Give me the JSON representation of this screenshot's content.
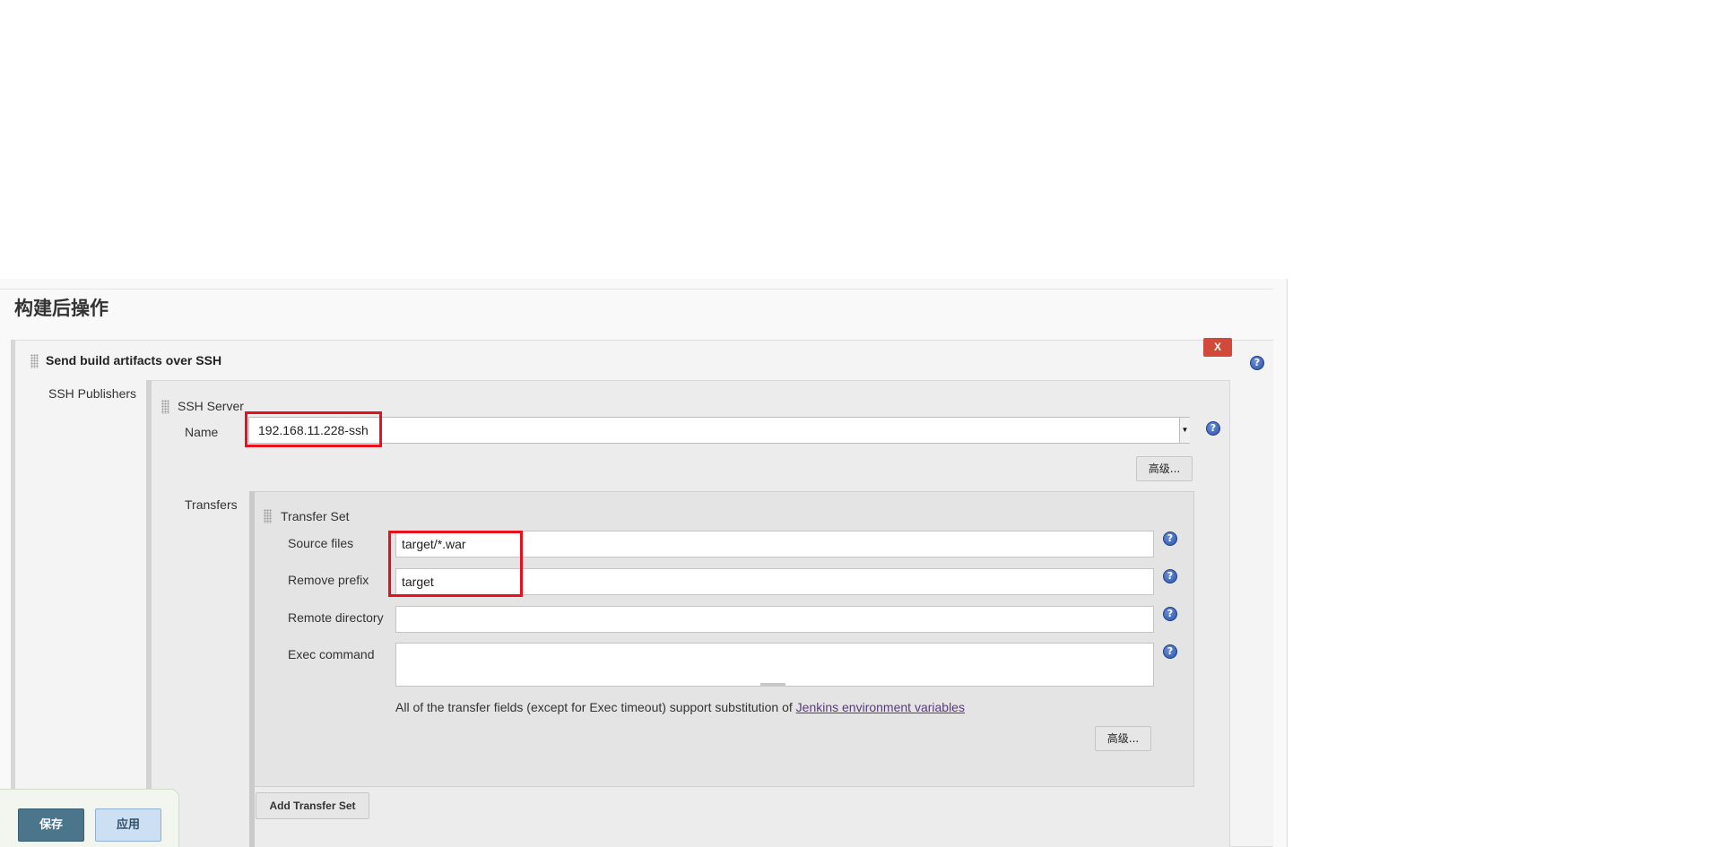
{
  "section": {
    "title": "构建后操作"
  },
  "publisher": {
    "title": "Send build artifacts over SSH",
    "delete_label": "X",
    "publishers_label": "SSH Publishers"
  },
  "ssh_server": {
    "heading": "SSH Server",
    "name_label": "Name",
    "name_value": "192.168.11.228-ssh",
    "advanced_label": "高级...",
    "transfers_label": "Transfers"
  },
  "transfer_set": {
    "heading": "Transfer Set",
    "source_files_label": "Source files",
    "source_files_value": "target/*.war",
    "remove_prefix_label": "Remove prefix",
    "remove_prefix_value": "target",
    "remote_directory_label": "Remote directory",
    "remote_directory_value": "",
    "exec_command_label": "Exec command",
    "exec_command_value": "",
    "info_text": "All of the transfer fields (except for Exec timeout) support substitution of ",
    "info_link": "Jenkins environment variables",
    "advanced_label": "高级...",
    "add_label": "Add Transfer Set"
  },
  "help_glyph": "?",
  "select_arrow_glyph": "▼",
  "footer": {
    "save_label": "保存",
    "apply_label": "应用"
  },
  "colors": {
    "highlight": "#e8101c",
    "delete": "#d24939",
    "save": "#4b758b",
    "apply": "#cddff2",
    "link": "#5b3a7c"
  }
}
